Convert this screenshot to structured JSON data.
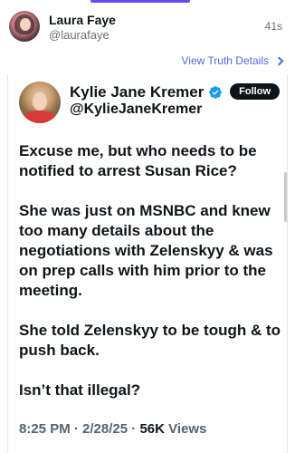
{
  "post": {
    "author": "Laura Faye",
    "handle": "@laurafaye",
    "time": "41s"
  },
  "view_link": "View Truth Details",
  "embed": {
    "name": "Kylie Jane Kremer",
    "handle": "@KylieJaneKremer",
    "follow_label": "Follow",
    "paragraphs": [
      "Excuse me, but who needs to be notified to arrest Susan Rice?",
      "She was just on MSNBC and knew too many details about the negotiations with Zelenskyy & was on prep calls with him prior to the meeting.",
      "She told Zelenskyy to be tough & to push back.",
      "Isn’t that illegal?"
    ],
    "time": "8:25 PM",
    "date": "2/28/25",
    "views_count": "56K",
    "views_label": "Views",
    "separator": "·"
  },
  "colors": {
    "accent": "#5b63e8",
    "verified": "#1d9bf0",
    "text": "#0f1419",
    "muted": "#536471"
  },
  "icons": {
    "verified": "verified-badge-icon",
    "chevron": "chevron-right-icon"
  }
}
